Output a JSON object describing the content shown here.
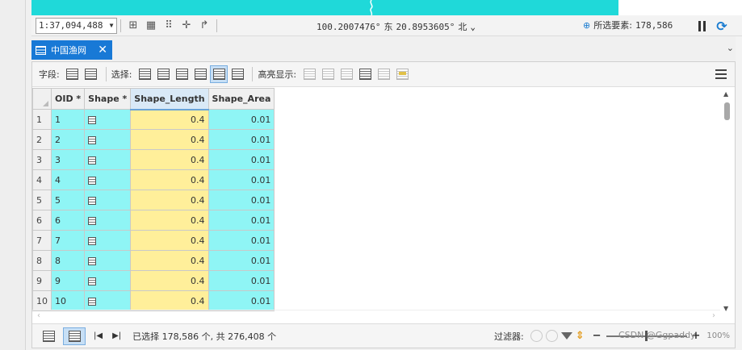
{
  "statusbar": {
    "scale": "1:37,094,488",
    "coord_x": "100.2007476°",
    "coord_x_dir": "东",
    "coord_y": "20.8953605°",
    "coord_y_dir": "北",
    "selected_label": "所选要素:",
    "selected_count": "178,586"
  },
  "tab": {
    "label": "中国渔网"
  },
  "toolbar": {
    "field_label": "字段:",
    "select_label": "选择:",
    "highlight_label": "高亮显示:"
  },
  "table": {
    "columns": [
      "OID *",
      "Shape *",
      "Shape_Length",
      "Shape_Area"
    ],
    "rows": [
      {
        "row": "1",
        "oid": "1",
        "length": "0.4",
        "area": "0.01"
      },
      {
        "row": "2",
        "oid": "2",
        "length": "0.4",
        "area": "0.01"
      },
      {
        "row": "3",
        "oid": "3",
        "length": "0.4",
        "area": "0.01"
      },
      {
        "row": "4",
        "oid": "4",
        "length": "0.4",
        "area": "0.01"
      },
      {
        "row": "5",
        "oid": "5",
        "length": "0.4",
        "area": "0.01"
      },
      {
        "row": "6",
        "oid": "6",
        "length": "0.4",
        "area": "0.01"
      },
      {
        "row": "7",
        "oid": "7",
        "length": "0.4",
        "area": "0.01"
      },
      {
        "row": "8",
        "oid": "8",
        "length": "0.4",
        "area": "0.01"
      },
      {
        "row": "9",
        "oid": "9",
        "length": "0.4",
        "area": "0.01"
      },
      {
        "row": "10",
        "oid": "10",
        "length": "0.4",
        "area": "0.01"
      }
    ]
  },
  "footer": {
    "selection_text": "已选择 178,586 个, 共 276,408 个",
    "filter_label": "过滤器:",
    "zoom_pct": "100%"
  },
  "watermark": "CSDN @Ggpaddy",
  "colors": {
    "accent": "#1879d6",
    "map": "#1fd9d9",
    "selected_row": "#8ff5f5",
    "highlight_cell": "#ffef9a"
  }
}
